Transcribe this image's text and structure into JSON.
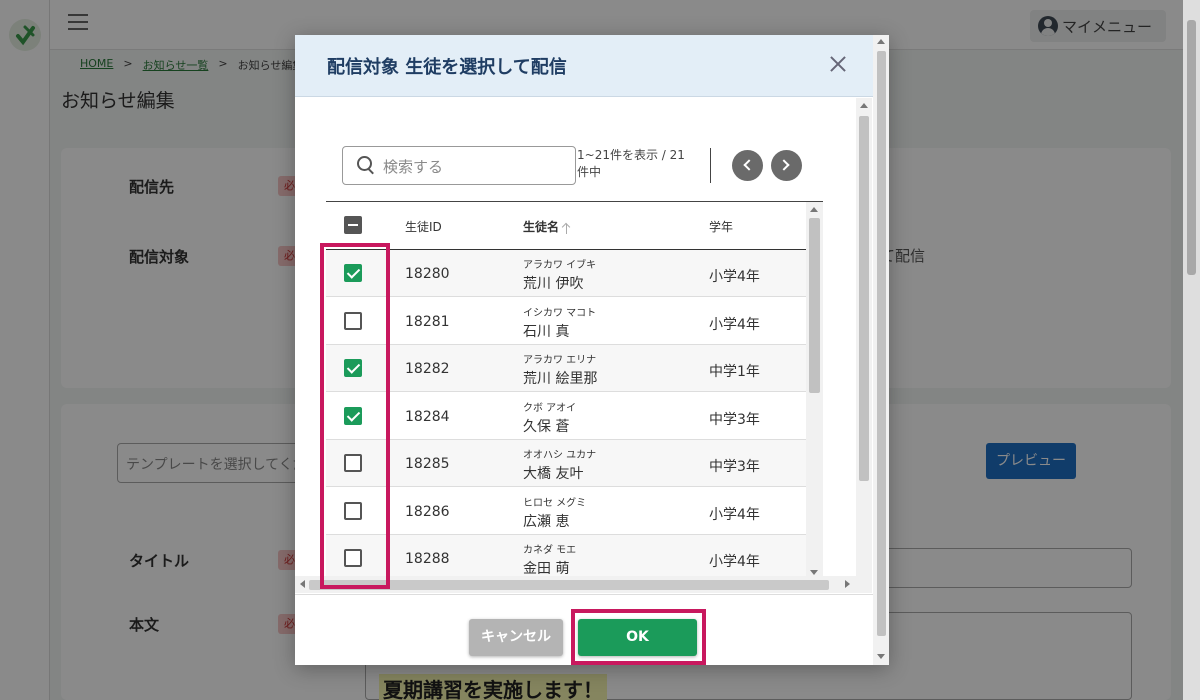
{
  "topbar": {
    "my_menu_label": "マイメニュー"
  },
  "breadcrumb": {
    "home": "HOME",
    "sep1": ">",
    "news_list": "お知らせ一覧",
    "sep2": ">",
    "current": "お知らせ編集"
  },
  "page": {
    "title": "お知らせ編集",
    "label_destination": "配信先",
    "label_target": "配信対象",
    "label_title": "タイトル",
    "label_body": "本文",
    "required_badge": "必",
    "target_suffix_text": "て配信",
    "template_placeholder": "テンプレートを選択してくださ",
    "preview_label": "プレビュー",
    "body_heading": "夏期講習を実施します！"
  },
  "modal": {
    "title": "配信対象 生徒を選択して配信",
    "search_placeholder": "検索する",
    "range_text": "1~21件を表示 / 21件中",
    "columns": {
      "student_id": "生徒ID",
      "student_name": "生徒名",
      "grade": "学年"
    },
    "rows": [
      {
        "id": "18280",
        "kana": "アラカワ イブキ",
        "name": "荒川 伊吹",
        "grade": "小学4年",
        "checked": true
      },
      {
        "id": "18281",
        "kana": "イシカワ マコト",
        "name": "石川 真",
        "grade": "小学4年",
        "checked": false
      },
      {
        "id": "18282",
        "kana": "アラカワ エリナ",
        "name": "荒川 絵里那",
        "grade": "中学1年",
        "checked": true
      },
      {
        "id": "18284",
        "kana": "クボ アオイ",
        "name": "久保 蒼",
        "grade": "中学3年",
        "checked": true
      },
      {
        "id": "18285",
        "kana": "オオハシ ユカナ",
        "name": "大橋 友叶",
        "grade": "中学3年",
        "checked": false
      },
      {
        "id": "18286",
        "kana": "ヒロセ メグミ",
        "name": "広瀬 恵",
        "grade": "小学4年",
        "checked": false
      },
      {
        "id": "18288",
        "kana": "カネダ モエ",
        "name": "金田 萌",
        "grade": "小学4年",
        "checked": false
      }
    ],
    "cancel_label": "キャンセル",
    "ok_label": "OK"
  },
  "colors": {
    "accent_green": "#1b9b5a",
    "highlight": "#c8185e",
    "header_bg": "#e3eef7",
    "preview_blue": "#1e6fc4"
  }
}
